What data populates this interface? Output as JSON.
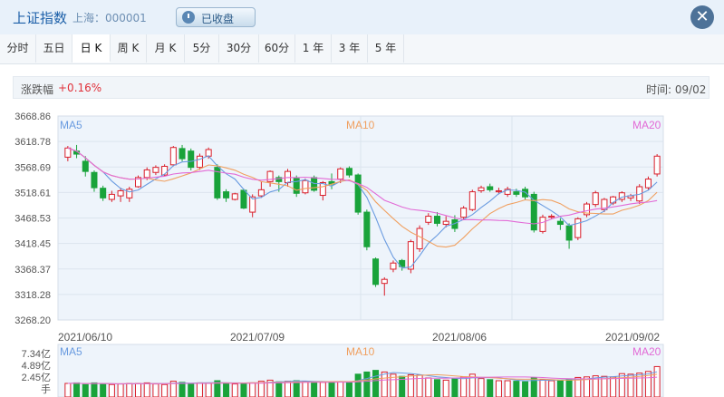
{
  "header": {
    "title": "上证指数",
    "subtitle": "上海：000001",
    "status_label": "已收盘",
    "close_glyph": "✕"
  },
  "tabs": [
    "分时",
    "五日",
    "日 K",
    "周 K",
    "月 K",
    "5分",
    "30分",
    "60分",
    "1 年",
    "3 年",
    "5 年"
  ],
  "active_tab": "日 K",
  "info": {
    "change_label": "涨跌幅",
    "change_value": "+0.16%",
    "time_label": "时间: 09/02"
  },
  "colors": {
    "up": "#d91f2b",
    "down": "#19a33a",
    "ma5": "#6a9be0",
    "ma10": "#f0a060",
    "ma20": "#e26ad6"
  },
  "chart_data": {
    "type": "candlestick",
    "y_ticks": [
      "3668.86",
      "3618.78",
      "3568.69",
      "3518.61",
      "3468.53",
      "3418.45",
      "3368.37",
      "3318.28",
      "3268.20"
    ],
    "ylim": [
      3268.2,
      3668.86
    ],
    "x_labels": [
      "2021/06/10",
      "2021/07/09",
      "2021/08/06",
      "2021/09/02"
    ],
    "ma_labels": [
      "MA5",
      "MA10",
      "MA20"
    ],
    "volume_ticks": [
      "7.34亿",
      "4.89亿",
      "2.45亿"
    ],
    "volume_unit": "手",
    "volume_ma_labels": [
      "MA5",
      "MA10",
      "MA20"
    ],
    "candles": [
      [
        3588,
        3606,
        3580,
        3610,
        2.5
      ],
      [
        3600,
        3594,
        3586,
        3612,
        2.6
      ],
      [
        3580,
        3560,
        3550,
        3590,
        2.3
      ],
      [
        3558,
        3528,
        3520,
        3562,
        2.6
      ],
      [
        3527,
        3508,
        3502,
        3532,
        2.4
      ],
      [
        3505,
        3515,
        3500,
        3522,
        2.3
      ],
      [
        3512,
        3522,
        3500,
        3528,
        2.4
      ],
      [
        3508,
        3525,
        3500,
        3530,
        2.5
      ],
      [
        3530,
        3548,
        3528,
        3552,
        2.5
      ],
      [
        3548,
        3563,
        3543,
        3568,
        2.6
      ],
      [
        3558,
        3568,
        3553,
        3572,
        2.4
      ],
      [
        3553,
        3570,
        3550,
        3574,
        2.3
      ],
      [
        3573,
        3607,
        3570,
        3610,
        2.9
      ],
      [
        3605,
        3585,
        3580,
        3612,
        2.7
      ],
      [
        3600,
        3568,
        3562,
        3605,
        2.5
      ],
      [
        3568,
        3590,
        3563,
        3595,
        2.6
      ],
      [
        3590,
        3603,
        3585,
        3607,
        2.5
      ],
      [
        3568,
        3508,
        3504,
        3574,
        3.0
      ],
      [
        3520,
        3508,
        3500,
        3525,
        2.5
      ],
      [
        3505,
        3516,
        3503,
        3518,
        2.4
      ],
      [
        3523,
        3488,
        3486,
        3526,
        2.5
      ],
      [
        3480,
        3510,
        3470,
        3515,
        2.6
      ],
      [
        3512,
        3524,
        3508,
        3540,
        2.9
      ],
      [
        3540,
        3560,
        3530,
        3562,
        3.1
      ],
      [
        3548,
        3540,
        3520,
        3552,
        2.8
      ],
      [
        3538,
        3560,
        3530,
        3565,
        2.9
      ],
      [
        3546,
        3517,
        3510,
        3552,
        3.0
      ],
      [
        3518,
        3542,
        3515,
        3546,
        2.9
      ],
      [
        3548,
        3523,
        3520,
        3552,
        2.8
      ],
      [
        3513,
        3538,
        3503,
        3541,
        2.7
      ],
      [
        3540,
        3535,
        3525,
        3556,
        2.7
      ],
      [
        3545,
        3565,
        3537,
        3568,
        2.8
      ],
      [
        3566,
        3553,
        3548,
        3570,
        2.7
      ],
      [
        3553,
        3480,
        3475,
        3556,
        4.2
      ],
      [
        3480,
        3412,
        3405,
        3485,
        4.6
      ],
      [
        3388,
        3338,
        3333,
        3391,
        4.9
      ],
      [
        3340,
        3348,
        3316,
        3352,
        4.6
      ],
      [
        3368,
        3380,
        3362,
        3385,
        4.2
      ],
      [
        3385,
        3373,
        3365,
        3388,
        3.8
      ],
      [
        3368,
        3422,
        3360,
        3426,
        4.1
      ],
      [
        3408,
        3448,
        3402,
        3454,
        4.0
      ],
      [
        3460,
        3472,
        3455,
        3478,
        3.5
      ],
      [
        3472,
        3458,
        3452,
        3480,
        3.2
      ],
      [
        3456,
        3462,
        3450,
        3472,
        3.1
      ],
      [
        3465,
        3448,
        3441,
        3474,
        3.4
      ],
      [
        3470,
        3488,
        3464,
        3492,
        3.7
      ],
      [
        3485,
        3520,
        3482,
        3524,
        4.2
      ],
      [
        3522,
        3528,
        3518,
        3532,
        3.4
      ],
      [
        3530,
        3524,
        3520,
        3536,
        3.2
      ],
      [
        3520,
        3522,
        3515,
        3528,
        3.0
      ],
      [
        3515,
        3525,
        3510,
        3530,
        3.0
      ],
      [
        3520,
        3515,
        3510,
        3526,
        2.9
      ],
      [
        3525,
        3510,
        3505,
        3530,
        2.8
      ],
      [
        3515,
        3445,
        3440,
        3520,
        3.5
      ],
      [
        3442,
        3470,
        3438,
        3475,
        3.2
      ],
      [
        3470,
        3472,
        3466,
        3476,
        3.0
      ],
      [
        3462,
        3456,
        3445,
        3468,
        3.1
      ],
      [
        3453,
        3425,
        3408,
        3458,
        3.3
      ],
      [
        3430,
        3467,
        3425,
        3470,
        3.6
      ],
      [
        3475,
        3496,
        3470,
        3500,
        3.7
      ],
      [
        3495,
        3518,
        3490,
        3522,
        3.9
      ],
      [
        3485,
        3505,
        3480,
        3508,
        3.8
      ],
      [
        3498,
        3510,
        3494,
        3512,
        3.7
      ],
      [
        3505,
        3518,
        3500,
        3521,
        4.3
      ],
      [
        3508,
        3512,
        3502,
        3516,
        4.2
      ],
      [
        3502,
        3530,
        3496,
        3535,
        4.4
      ],
      [
        3528,
        3545,
        3524,
        3550,
        4.7
      ],
      [
        3555,
        3590,
        3550,
        3594,
        5.6
      ]
    ]
  }
}
